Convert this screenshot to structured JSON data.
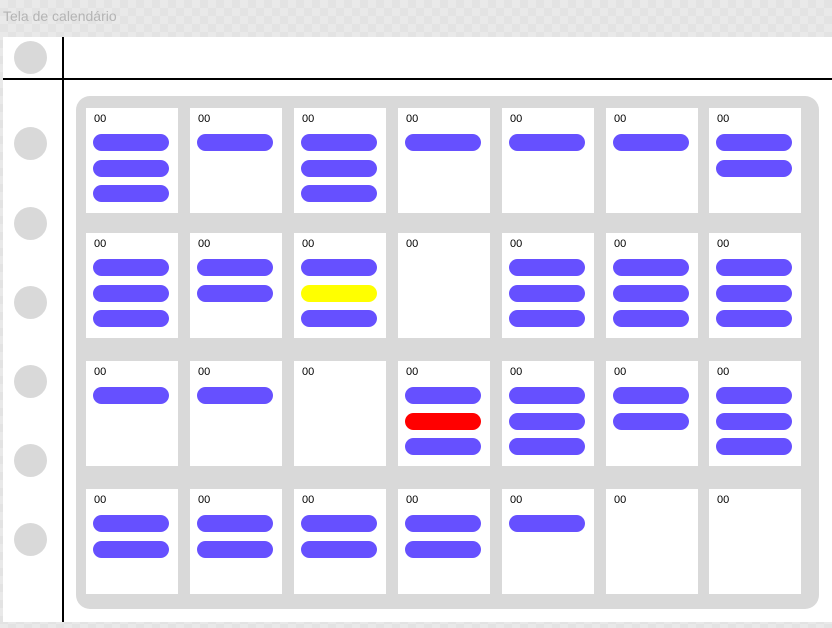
{
  "app": {
    "title": "Tela de calendário"
  },
  "colors": {
    "event": "#6650ff",
    "highlight": "#ffff00",
    "alert": "#ff0000",
    "panel": "#d9d9d9",
    "rule": "#000000"
  },
  "sidebar": {
    "nav_dots": 7
  },
  "calendar": {
    "weeks": [
      [
        {
          "day": "00",
          "events": [
            "default",
            "default",
            "default"
          ]
        },
        {
          "day": "00",
          "events": [
            "default"
          ]
        },
        {
          "day": "00",
          "events": [
            "default",
            "default",
            "default"
          ]
        },
        {
          "day": "00",
          "events": [
            "default"
          ]
        },
        {
          "day": "00",
          "events": [
            "default"
          ]
        },
        {
          "day": "00",
          "events": [
            "default"
          ]
        },
        {
          "day": "00",
          "events": [
            "default",
            "default"
          ]
        }
      ],
      [
        {
          "day": "00",
          "events": [
            "default",
            "default",
            "default"
          ]
        },
        {
          "day": "00",
          "events": [
            "default",
            "default"
          ]
        },
        {
          "day": "00",
          "events": [
            "default",
            "highlight",
            "default"
          ]
        },
        {
          "day": "00",
          "events": []
        },
        {
          "day": "00",
          "events": [
            "default",
            "default",
            "default"
          ]
        },
        {
          "day": "00",
          "events": [
            "default",
            "default",
            "default"
          ]
        },
        {
          "day": "00",
          "events": [
            "default",
            "default",
            "default"
          ]
        }
      ],
      [
        {
          "day": "00",
          "events": [
            "default"
          ]
        },
        {
          "day": "00",
          "events": [
            "default"
          ]
        },
        {
          "day": "00",
          "events": []
        },
        {
          "day": "00",
          "events": [
            "default",
            "alert",
            "default"
          ]
        },
        {
          "day": "00",
          "events": [
            "default",
            "default",
            "default"
          ]
        },
        {
          "day": "00",
          "events": [
            "default",
            "default"
          ]
        },
        {
          "day": "00",
          "events": [
            "default",
            "default",
            "default"
          ]
        }
      ],
      [
        {
          "day": "00",
          "events": [
            "default",
            "default"
          ]
        },
        {
          "day": "00",
          "events": [
            "default",
            "default"
          ]
        },
        {
          "day": "00",
          "events": [
            "default",
            "default"
          ]
        },
        {
          "day": "00",
          "events": [
            "default",
            "default"
          ]
        },
        {
          "day": "00",
          "events": [
            "default"
          ]
        },
        {
          "day": "00",
          "events": []
        },
        {
          "day": "00",
          "events": []
        }
      ]
    ]
  }
}
